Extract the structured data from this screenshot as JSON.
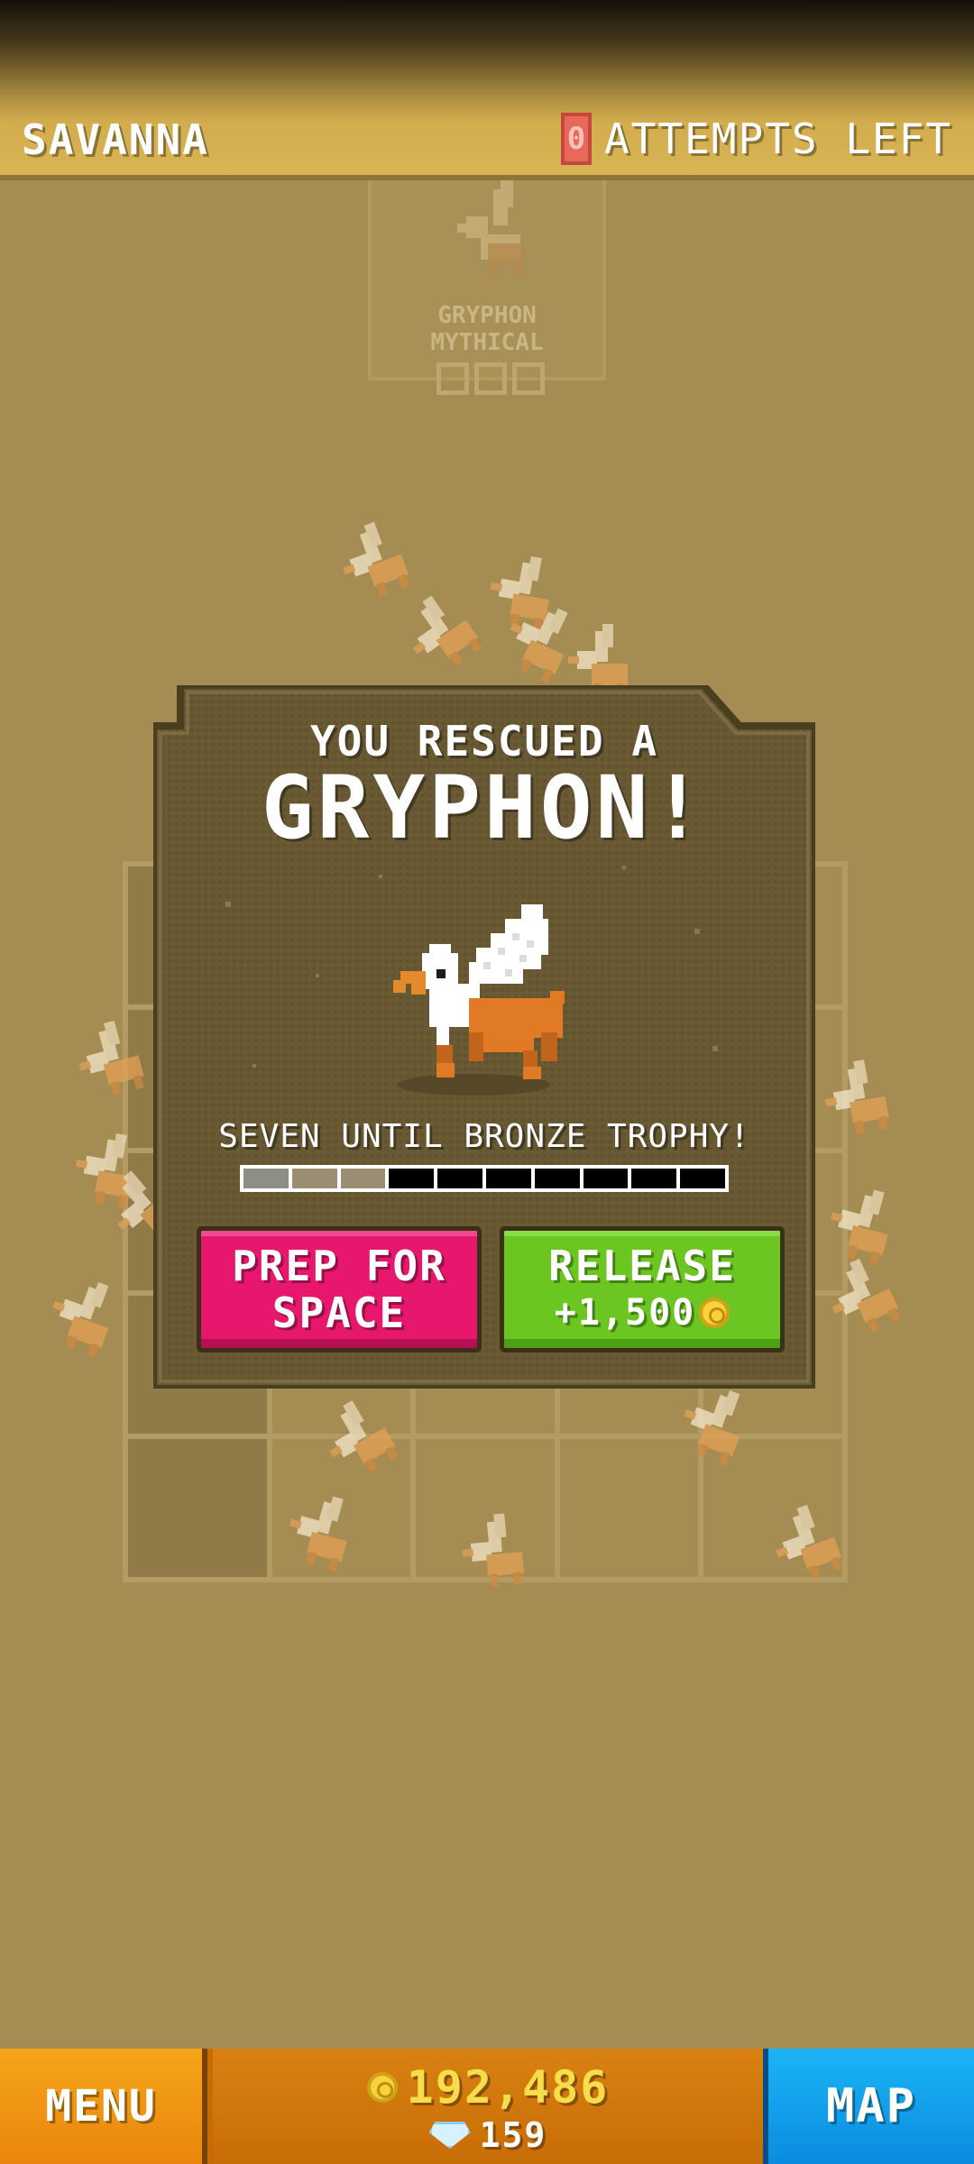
{
  "topbar": {
    "zone": "SAVANNA",
    "attempts_count": "0",
    "attempts_label": "ATTEMPTS LEFT"
  },
  "background_card": {
    "name_line1": "GRYPHON",
    "name_line2": "MYTHICAL"
  },
  "dialog": {
    "headline": "YOU RESCUED A",
    "animal_name": "GRYPHON!",
    "trophy_text": "SEVEN UNTIL BRONZE TROPHY!",
    "trophy_progress": {
      "filled": 3,
      "total": 10
    },
    "prep_button": {
      "line1": "PREP FOR",
      "line2": "SPACE"
    },
    "release_button": {
      "line1": "RELEASE",
      "reward": "+1,500"
    }
  },
  "bottombar": {
    "menu_label": "MENU",
    "coins": "192,486",
    "gems": "159",
    "map_label": "MAP"
  },
  "icons": [
    "coin-icon",
    "gem-icon",
    "gryphon-sprite"
  ],
  "colors": {
    "background": "#a58c52",
    "prep_button": "#e7176d",
    "release_button": "#6cc622",
    "menu_button": "#f0960f",
    "map_button": "#0fa0ec"
  }
}
